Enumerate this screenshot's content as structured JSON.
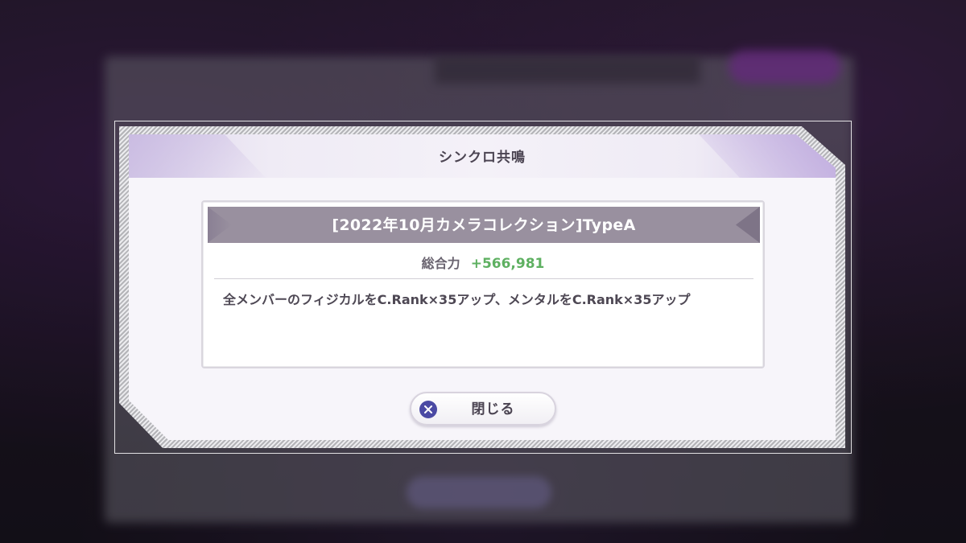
{
  "dialog": {
    "title": "シンクロ共鳴"
  },
  "skill": {
    "name": "[2022年10月カメラコレクション]TypeA",
    "power_label": "総合力",
    "power_value": "+566,981",
    "description": "全メンバーのフィジカルをC.Rank×35アップ、メンタルをC.Rank×35アップ"
  },
  "close_button": {
    "label": "閉じる",
    "icon": "close-icon"
  },
  "colors": {
    "power_value": "#5eb061",
    "skill_header": "#99909f",
    "close_icon": "#4b4aa4"
  }
}
